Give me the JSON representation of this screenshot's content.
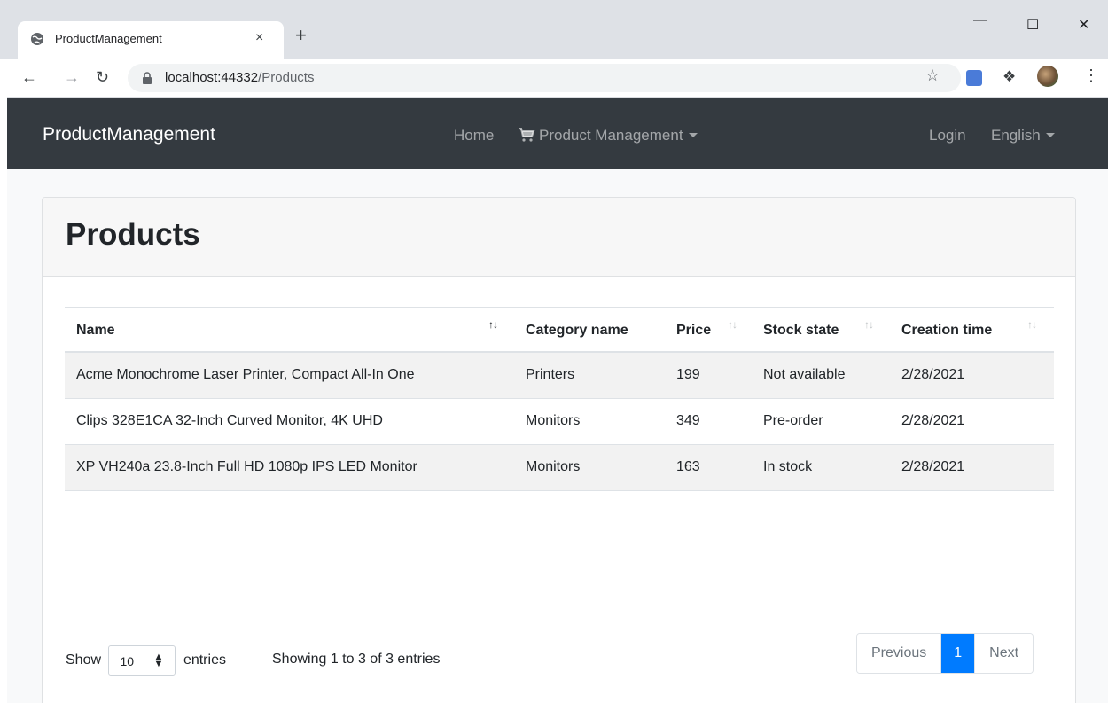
{
  "browser": {
    "tab_title": "ProductManagement",
    "tab_close": "×",
    "new_tab": "+",
    "url_host": "localhost:44332",
    "url_path": "/Products",
    "window_min": "—",
    "window_max": "☐",
    "window_close": "✕"
  },
  "navbar": {
    "brand": "ProductManagement",
    "home": "Home",
    "product_management": "Product Management",
    "login": "Login",
    "language": "English"
  },
  "page": {
    "title": "Products"
  },
  "table": {
    "columns": [
      "Name",
      "Category name",
      "Price",
      "Stock state",
      "Creation time"
    ],
    "rows": [
      {
        "name": "Acme Monochrome Laser Printer, Compact All-In One",
        "category": "Printers",
        "price": "199",
        "stock": "Not available",
        "created": "2/28/2021"
      },
      {
        "name": "Clips 328E1CA 32-Inch Curved Monitor, 4K UHD",
        "category": "Monitors",
        "price": "349",
        "stock": "Pre-order",
        "created": "2/28/2021"
      },
      {
        "name": "XP VH240a 23.8-Inch Full HD 1080p IPS LED Monitor",
        "category": "Monitors",
        "price": "163",
        "stock": "In stock",
        "created": "2/28/2021"
      }
    ]
  },
  "footer": {
    "show": "Show",
    "page_length": "10",
    "entries": "entries",
    "info": "Showing 1 to 3 of 3 entries",
    "previous": "Previous",
    "current_page": "1",
    "next": "Next"
  },
  "colors": {
    "navbar_bg": "#343a40",
    "accent": "#007bff"
  }
}
